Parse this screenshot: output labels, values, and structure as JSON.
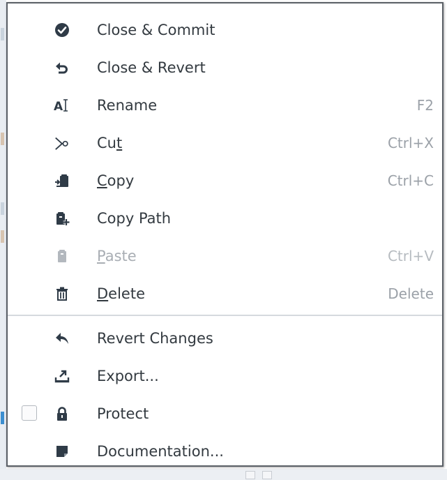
{
  "menu": {
    "items": [
      {
        "label": "Close & Commit",
        "icon": "check-circle-icon",
        "shortcut": "",
        "enabled": true
      },
      {
        "label": "Close & Revert",
        "icon": "undo-icon",
        "shortcut": "",
        "enabled": true
      },
      {
        "label": "Rename",
        "icon": "text-cursor-icon",
        "shortcut": "F2",
        "enabled": true
      },
      {
        "label_pre": "Cu",
        "label_ul": "t",
        "icon": "scissors-icon",
        "shortcut": "Ctrl+X",
        "enabled": true
      },
      {
        "label": "Copy",
        "underline": "C",
        "icon": "copy-icon",
        "shortcut": "Ctrl+C",
        "enabled": true
      },
      {
        "label": "Copy Path",
        "icon": "clipboard-plus-icon",
        "shortcut": "",
        "enabled": true
      },
      {
        "label": "Paste",
        "underline": "P",
        "icon": "clipboard-icon",
        "shortcut": "Ctrl+V",
        "enabled": false
      },
      {
        "label": "Delete",
        "underline": "D",
        "icon": "trash-icon",
        "shortcut": "Delete",
        "enabled": true
      },
      {
        "label": "Revert Changes",
        "icon": "reply-arrow-icon",
        "shortcut": "",
        "enabled": true
      },
      {
        "label": "Export...",
        "icon": "export-icon",
        "shortcut": "",
        "enabled": true
      },
      {
        "label": "Protect",
        "icon": "lock-icon",
        "shortcut": "",
        "enabled": true,
        "checkbox": false
      },
      {
        "label": "Documentation...",
        "icon": "document-icon",
        "shortcut": "",
        "enabled": true
      }
    ]
  },
  "colors": {
    "icon": "#2f3b47",
    "icon_disabled": "#b3b8be",
    "text": "#333a40",
    "text_disabled": "#a9aeb4",
    "shortcut": "#9ba1a8",
    "separator": "#d5d9de",
    "border": "#5a5f66"
  }
}
